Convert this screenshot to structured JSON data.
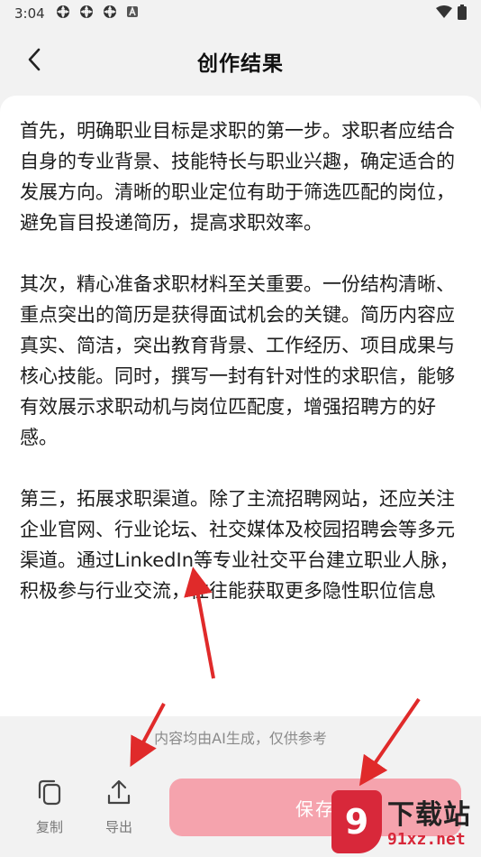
{
  "status_bar": {
    "time": "3:04",
    "notification_icons": [
      "notification-icon",
      "notification-icon",
      "notification-icon",
      "notification-icon"
    ],
    "right_icons": [
      "wifi-icon",
      "battery-icon"
    ]
  },
  "header": {
    "title": "创作结果",
    "back_icon": "chevron-left-icon"
  },
  "content": {
    "paragraphs": [
      "首先，明确职业目标是求职的第一步。求职者应结合自身的专业背景、技能特长与职业兴趣，确定适合的发展方向。清晰的职业定位有助于筛选匹配的岗位，避免盲目投递简历，提高求职效率。",
      "其次，精心准备求职材料至关重要。一份结构清晰、重点突出的简历是获得面试机会的关键。简历内容应真实、简洁，突出教育背景、工作经历、项目成果与核心技能。同时，撰写一封有针对性的求职信，能够有效展示求职动机与岗位匹配度，增强招聘方的好感。",
      "第三，拓展求职渠道。除了主流招聘网站，还应关注企业官网、行业论坛、社交媒体及校园招聘会等多元渠道。通过LinkedIn等专业社交平台建立职业人脉，积极参与行业交流，往往能获取更多隐性职位信息"
    ]
  },
  "disclaimer": "内容均由AI生成，仅供参考",
  "bottom_bar": {
    "copy_label": "复制",
    "export_label": "导出",
    "save_label": "保存"
  },
  "watermark": {
    "logo_text": "9",
    "title": "下载站",
    "url": "91xz.net"
  },
  "colors": {
    "save_button": "#f5a3ad",
    "annotation_arrow": "#e02a2a",
    "background": "#f2f2f2"
  }
}
